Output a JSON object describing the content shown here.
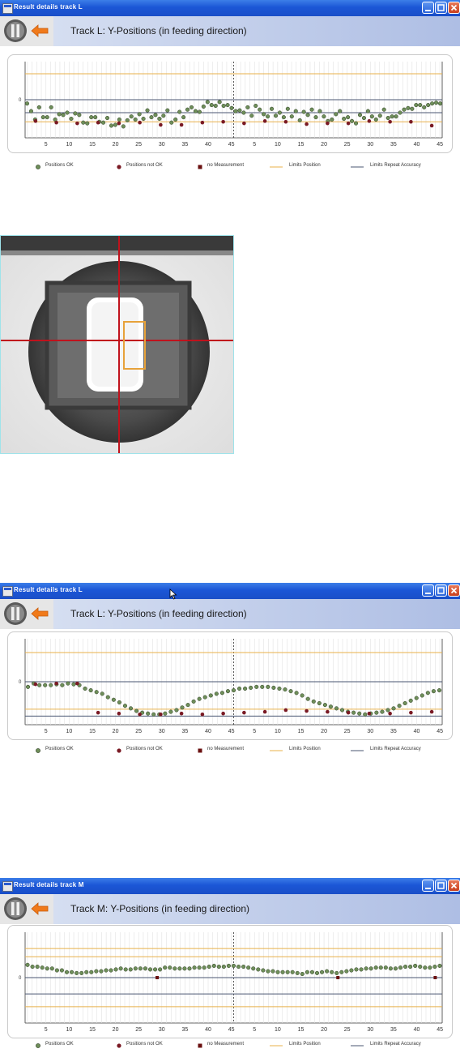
{
  "windows": [
    {
      "title": "Result details track L",
      "header": "Track L: Y-Positions (in feeding direction)",
      "zero_label": "0",
      "ticks": [
        "5",
        "10",
        "15",
        "20",
        "25",
        "30",
        "35",
        "40",
        "45",
        "5",
        "10",
        "15",
        "20",
        "25",
        "30",
        "35",
        "40",
        "45"
      ],
      "legend": [
        "Positions OK",
        "Positions not OK",
        "no Measurement",
        "Limits Position",
        "Limits Repeat Accuracy"
      ]
    },
    {
      "title": "Result details track L",
      "header": "Track L: Y-Positions (in feeding direction)",
      "zero_label": "0",
      "ticks": [
        "5",
        "10",
        "15",
        "20",
        "25",
        "30",
        "35",
        "40",
        "45",
        "5",
        "10",
        "15",
        "20",
        "25",
        "30",
        "35",
        "40",
        "45"
      ],
      "legend": [
        "Positions OK",
        "Positions not OK",
        "no Measurement",
        "Limits Position",
        "Limits Repeat Accuracy"
      ]
    },
    {
      "title": "Result details track M",
      "header": "Track M: Y-Positions (in feeding direction)",
      "zero_label": "0",
      "ticks": [
        "5",
        "10",
        "15",
        "20",
        "25",
        "30",
        "35",
        "40",
        "45",
        "5",
        "10",
        "15",
        "20",
        "25",
        "30",
        "35",
        "40",
        "45"
      ],
      "legend": [
        "Positions OK",
        "Positions not OK",
        "no Measurement",
        "Limits Position",
        "Limits Repeat Accuracy"
      ]
    }
  ],
  "colors": {
    "titlebar": "#1b56d6",
    "ok": "#6f8f5a",
    "not_ok": "#7a1a24",
    "no_measurement": "#6a1010",
    "limits_position": "#e8b04a",
    "limits_repeat": "#4a5672",
    "crosshair": "#c0121c",
    "roi": "#e7a23a"
  },
  "chart_data": [
    {
      "type": "scatter",
      "title": "Track L: Y-Positions (in feeding direction)",
      "x": "index 1-45 (two cycles)",
      "ylim": [
        -5,
        5
      ],
      "limits_position": [
        3.4,
        -2.9
      ],
      "limits_repeat": [
        0,
        -1.7
      ],
      "series": [
        {
          "name": "Positions OK",
          "values": [
            -0.5,
            -1.5,
            -2.6,
            -1.0,
            -2.3,
            -2.3,
            -1.0,
            -2.6,
            -1.9,
            -2.0,
            -1.7,
            -2.5,
            -1.8,
            -2.0,
            -3.0,
            -3.1,
            -2.3,
            -2.3,
            -2.9,
            -3.0,
            -2.4,
            -3.4,
            -3.3,
            -2.6,
            -3.5,
            -2.7,
            -2.2,
            -2.6,
            -1.9,
            -2.5,
            -1.4,
            -2.3,
            -2.0,
            -2.5,
            -2.1,
            -1.4,
            -3.0,
            -2.6,
            -1.6,
            -2.3,
            -1.3,
            -1.0,
            -1.5,
            -1.6,
            -0.9,
            -0.3,
            -0.7,
            -0.8,
            -0.3,
            -0.8,
            -0.7,
            -1.1,
            -1.5,
            -1.4,
            -1.7,
            -1.0,
            -2.1,
            -0.8,
            -1.3,
            -1.9,
            -2.2,
            -1.2,
            -2.1,
            -1.7,
            -2.3,
            -1.2,
            -2.2,
            -1.5,
            -2.7,
            -1.6,
            -2.0,
            -1.3,
            -2.3,
            -1.5,
            -2.2,
            -2.8,
            -2.6,
            -1.9,
            -1.5,
            -2.5,
            -2.3,
            -2.8,
            -3.1,
            -2.0,
            -2.4,
            -1.5,
            -2.2,
            -2.6,
            -2.1,
            -1.3,
            -2.4,
            -2.2,
            -2.2,
            -1.7,
            -1.3,
            -1.1,
            -1.2,
            -0.7,
            -0.7,
            -1.0,
            -0.7,
            -0.5,
            -0.4,
            -0.5
          ]
        },
        {
          "name": "Positions not OK",
          "values": [
            -2.8,
            -3.0,
            -3.1,
            -3.0,
            -3.1,
            -3.0,
            -3.3,
            -3.3,
            -3.0,
            -2.9,
            -3.1,
            -2.8,
            -2.9,
            -3.2,
            -3.1,
            -3.1,
            -2.8,
            -2.9,
            -2.9,
            -3.4
          ]
        }
      ]
    },
    {
      "type": "scatter",
      "title": "Track L: Y-Positions (in feeding direction)",
      "x": "index 1-45 (two cycles)",
      "ylim": [
        -5,
        5
      ],
      "limits_position": [
        3.4,
        -3.2
      ],
      "limits_repeat": [
        0,
        -4.0
      ],
      "series": [
        {
          "name": "Positions OK",
          "values": [
            -0.6,
            -0.2,
            -0.4,
            -0.4,
            -0.4,
            -0.3,
            -0.4,
            -0.2,
            -0.3,
            -0.4,
            -0.8,
            -1.0,
            -1.2,
            -1.4,
            -1.8,
            -2.1,
            -2.4,
            -2.8,
            -3.1,
            -3.4,
            -3.6,
            -3.7,
            -3.8,
            -3.8,
            -3.7,
            -3.5,
            -3.3,
            -3.0,
            -2.7,
            -2.3,
            -2.0,
            -1.8,
            -1.6,
            -1.4,
            -1.3,
            -1.1,
            -1.0,
            -0.8,
            -0.8,
            -0.7,
            -0.6,
            -0.6,
            -0.6,
            -0.7,
            -0.8,
            -0.9,
            -1.1,
            -1.3,
            -1.6,
            -2.0,
            -2.3,
            -2.5,
            -2.7,
            -2.9,
            -3.1,
            -3.3,
            -3.5,
            -3.6,
            -3.7,
            -3.8,
            -3.7,
            -3.6,
            -3.5,
            -3.3,
            -3.1,
            -2.8,
            -2.5,
            -2.2,
            -1.9,
            -1.6,
            -1.3,
            -1.1,
            -1.0
          ]
        },
        {
          "name": "Positions not OK",
          "values": [
            -0.3,
            -0.2,
            -0.2,
            -3.6,
            -3.7,
            -3.8,
            -3.8,
            -3.7,
            -3.8,
            -3.7,
            -3.6,
            -3.5,
            -3.3,
            -3.4,
            -3.5,
            -3.6,
            -3.7,
            -3.7,
            -3.6,
            -3.5
          ]
        }
      ]
    },
    {
      "type": "scatter",
      "title": "Track M: Y-Positions (in feeding direction)",
      "x": "index 1-45 (two cycles)",
      "ylim": [
        -5,
        5
      ],
      "limits_position": [
        3.2,
        2.3,
        -3.2
      ],
      "limits_repeat": [
        0,
        -1.8
      ],
      "series": [
        {
          "name": "Positions OK",
          "values": [
            1.4,
            1.2,
            1.2,
            1.1,
            1.0,
            1.0,
            0.8,
            0.8,
            0.6,
            0.6,
            0.5,
            0.5,
            0.6,
            0.6,
            0.7,
            0.7,
            0.8,
            0.8,
            0.9,
            1.0,
            0.9,
            0.9,
            1.0,
            1.0,
            1.0,
            0.9,
            0.9,
            0.9,
            1.1,
            1.1,
            1.0,
            1.0,
            1.0,
            1.0,
            1.1,
            1.1,
            1.1,
            1.2,
            1.3,
            1.2,
            1.2,
            1.3,
            1.3,
            1.2,
            1.2,
            1.1,
            1.0,
            0.9,
            0.8,
            0.7,
            0.7,
            0.6,
            0.6,
            0.6,
            0.6,
            0.5,
            0.4,
            0.6,
            0.6,
            0.5,
            0.6,
            0.7,
            0.6,
            0.5,
            0.6,
            0.7,
            0.8,
            0.9,
            0.9,
            1.0,
            1.0,
            1.1,
            1.1,
            1.1,
            1.0,
            1.0,
            1.1,
            1.2,
            1.2,
            1.3,
            1.2,
            1.1,
            1.1,
            1.2,
            1.3
          ]
        },
        {
          "name": "no Measurement",
          "values": [
            0,
            0,
            0
          ]
        }
      ]
    }
  ]
}
